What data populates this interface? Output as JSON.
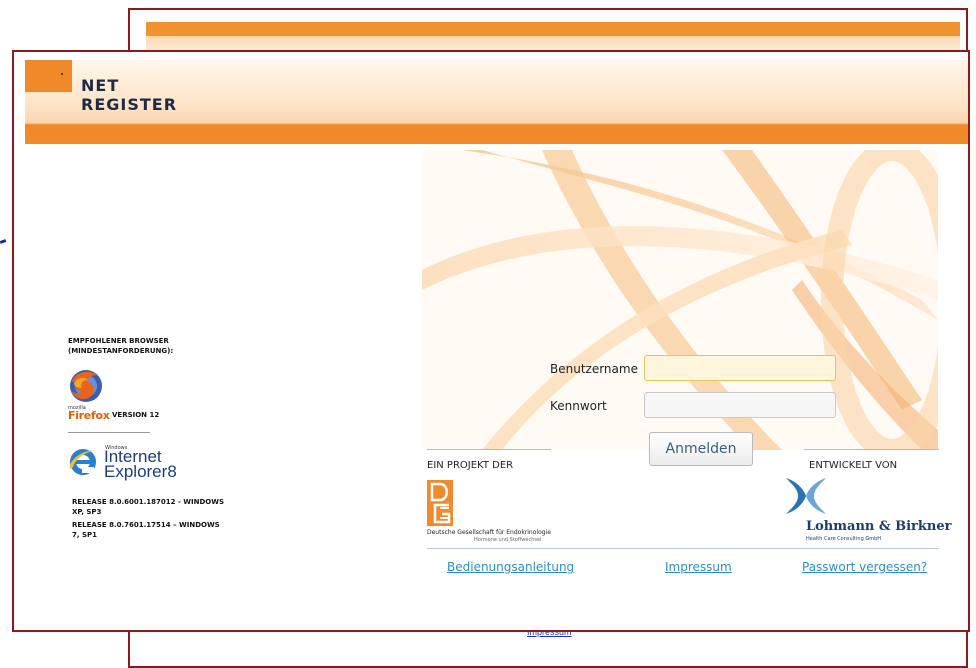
{
  "header": {
    "logo_line1": "NET",
    "logo_line2": "REGISTER"
  },
  "browser_panel": {
    "title": "EMPFOHLENER BROWSER (MINDESTANFORDERUNG):",
    "firefox_small": "mozilla",
    "firefox_name": "Firefox",
    "firefox_version": "VERSION 12",
    "ie_windows": "Windows",
    "ie_name_line1": "Internet",
    "ie_name_line2": "Explorer",
    "ie_version": "8",
    "release1": "RELEASE 8.0.6001.187012 - WINDOWS XP, SP3",
    "release2": "RELEASE 8.0.7601.17514 – WINDOWS 7, SP1"
  },
  "login": {
    "username_label": "Benutzername",
    "username_value": "",
    "password_label": "Kennwort",
    "password_value": "",
    "submit_label": "Anmelden"
  },
  "project": {
    "title": "EIN PROJEKT DER",
    "org_name": "Deutsche Gesellschaft für Endokrinologie",
    "org_sub": "Hormone und Stoffwechsel"
  },
  "developer": {
    "title": "ENTWICKELT VON",
    "company": "Lohmann & Birkner",
    "company_sub": "Health Care Consulting GmbH"
  },
  "footer": {
    "link_manual": "Bedienungsanleitung",
    "link_impressum": "Impressum",
    "link_password": "Passwort vergessen?"
  },
  "background_window": {
    "impressum_link": "Impressum"
  },
  "colors": {
    "accent_orange": "#f08a2c",
    "window_border": "#8b1a1a",
    "link_blue": "#2b8fc7",
    "brand_navy": "#1a3d6c"
  }
}
